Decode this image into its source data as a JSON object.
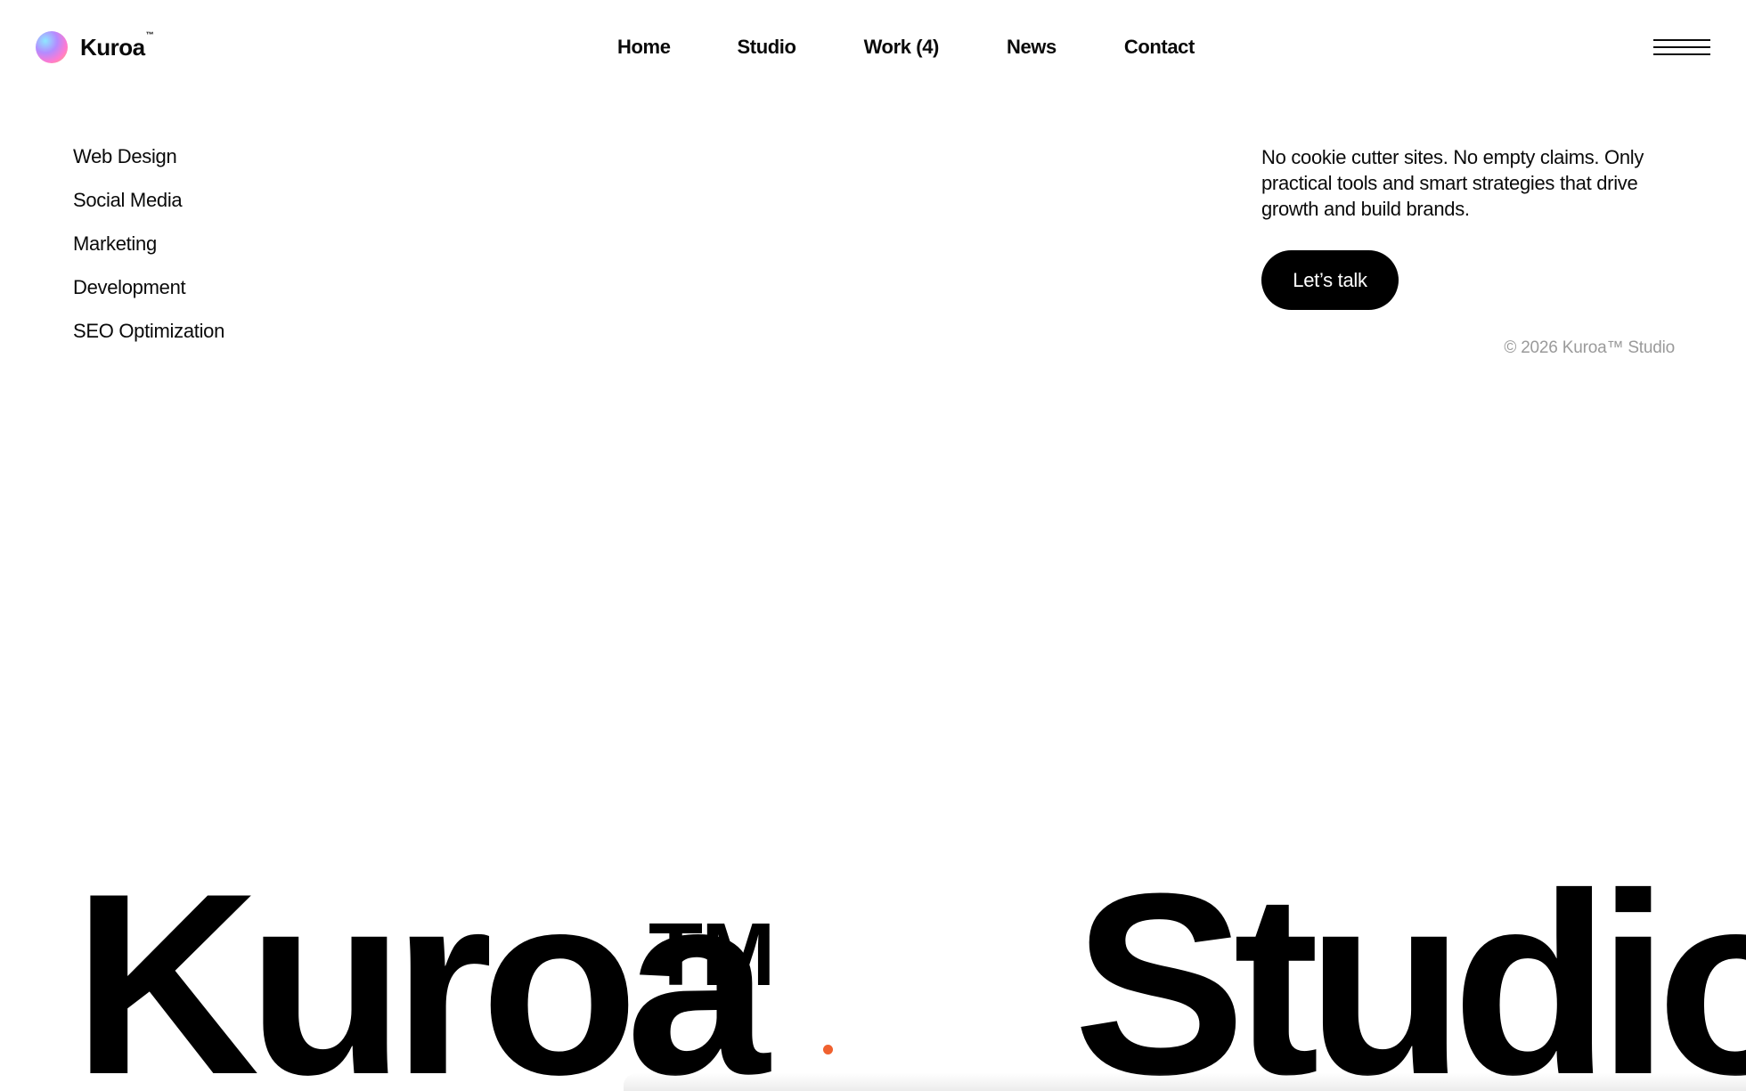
{
  "header": {
    "brand_name": "Kuroa",
    "brand_tm": "™",
    "nav": [
      {
        "label": "Home"
      },
      {
        "label": "Studio"
      },
      {
        "label": "Work (4)"
      },
      {
        "label": "News"
      },
      {
        "label": "Contact"
      }
    ],
    "menu_icon": "hamburger-menu-icon"
  },
  "services": [
    "Web Design",
    "Social Media",
    "Marketing",
    "Development",
    "SEO Optimization"
  ],
  "intro": {
    "text": "No cookie cutter sites. No empty claims. Only practical tools and smart strategies that drive growth and build brands.",
    "cta_label": "Let’s talk",
    "copyright": "© 2026 Kuroa™ Studio"
  },
  "wordmark": {
    "left_word": "Kuroa",
    "tm": "TM",
    "right_word": "Studio"
  },
  "colors": {
    "text": "#0a0a0a",
    "background": "#ffffff",
    "cta_bg": "#000000",
    "cta_text": "#ffffff",
    "muted": "#9a9a9a",
    "accent_dot": "#f0612f"
  }
}
